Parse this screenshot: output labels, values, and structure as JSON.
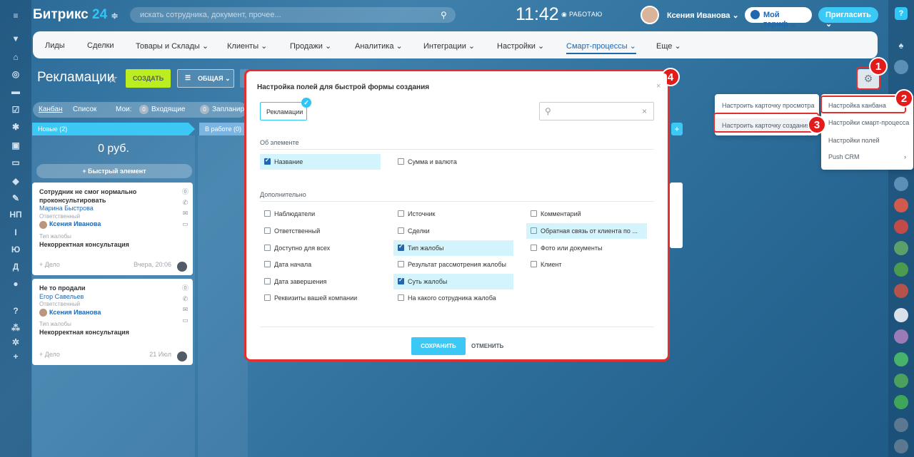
{
  "header": {
    "logo_text": "Битрикс",
    "logo_num": "24",
    "search_placeholder": "искать сотрудника, документ, прочее...",
    "clock": "11:42",
    "status": "РАБОТАЮ",
    "user_name": "Ксения Иванова",
    "tariff_label": "Мой тариф",
    "invite_label": "Пригласить"
  },
  "left_rail": [
    "НП",
    "І",
    "Ю",
    "Д"
  ],
  "menu": {
    "items": [
      "Лиды",
      "Сделки",
      "Товары и Склады ⌄",
      "Клиенты ⌄",
      "Продажи ⌄",
      "Аналитика ⌄",
      "Интеграции ⌄",
      "Настройки ⌄",
      "Смарт-процессы ⌄",
      "Еще ⌄"
    ],
    "active_index": 8
  },
  "toolbar": {
    "title": "Рекламации",
    "create_label": "СОЗДАТЬ",
    "filter_label": "ОБЩАЯ"
  },
  "view_bar": {
    "kanban": "Канбан",
    "list": "Список",
    "my": "Мои:",
    "incoming_count": "0",
    "incoming": "Входящие",
    "planned_count": "0",
    "planned": "Запланир"
  },
  "kanban": {
    "col1": "Новые (2)",
    "col2": "В работе (0)",
    "sum": "0 руб.",
    "quick_add": "+ Быстрый элемент",
    "cards": [
      {
        "title": "Сотрудник не смог нормально проконсультировать",
        "client": "Марина Быстрова",
        "resp_label": "Ответственный",
        "resp": "Ксения Иванова",
        "type_label": "Тип жалобы",
        "type": "Некорректная консультация",
        "deal": "+ Дело",
        "date": "Вчера, 20:06"
      },
      {
        "title": "Не то продали",
        "client": "Егор Савельев",
        "resp_label": "Ответственный",
        "resp": "Ксения Иванова",
        "type_label": "Тип жалобы",
        "type": "Некорректная консультация",
        "deal": "+ Дело",
        "date": "21 Июл"
      }
    ]
  },
  "settings_menu": {
    "left": [
      "Настроить карточку просмотра",
      "Настроить карточку создания"
    ],
    "right": [
      "Настройка канбана",
      "Настройки смарт-процесса",
      "Настройки полей",
      "Push CRM"
    ]
  },
  "badges": [
    "1",
    "2",
    "3",
    "4"
  ],
  "modal": {
    "title": "Настройка полей для быстрой формы создания",
    "tag": "Рекламации",
    "section1": "Об элементе",
    "section2": "Дополнительно",
    "fields_main": [
      {
        "label": "Название",
        "checked": true
      },
      {
        "label": "Сумма и валюта",
        "checked": false
      }
    ],
    "fields_col1": [
      {
        "label": "Наблюдатели",
        "checked": false
      },
      {
        "label": "Ответственный",
        "checked": false
      },
      {
        "label": "Доступно для всех",
        "checked": false
      },
      {
        "label": "Дата начала",
        "checked": false
      },
      {
        "label": "Дата завершения",
        "checked": false
      },
      {
        "label": "Реквизиты вашей компании",
        "checked": false
      }
    ],
    "fields_col2": [
      {
        "label": "Источник",
        "checked": false
      },
      {
        "label": "Сделки",
        "checked": false
      },
      {
        "label": "Тип жалобы",
        "checked": true
      },
      {
        "label": "Результат рассмотрения жалобы",
        "checked": false
      },
      {
        "label": "Суть жалобы",
        "checked": true
      },
      {
        "label": "На какого сотрудника жалоба",
        "checked": false
      }
    ],
    "fields_col3": [
      {
        "label": "Комментарий",
        "checked": false
      },
      {
        "label": "Обратная связь от клиента по ...",
        "checked": false
      },
      {
        "label": "Фото или документы",
        "checked": false
      },
      {
        "label": "Клиент",
        "checked": false
      }
    ],
    "save_label": "СОХРАНИТЬ",
    "cancel_label": "ОТМЕНИТЬ"
  }
}
